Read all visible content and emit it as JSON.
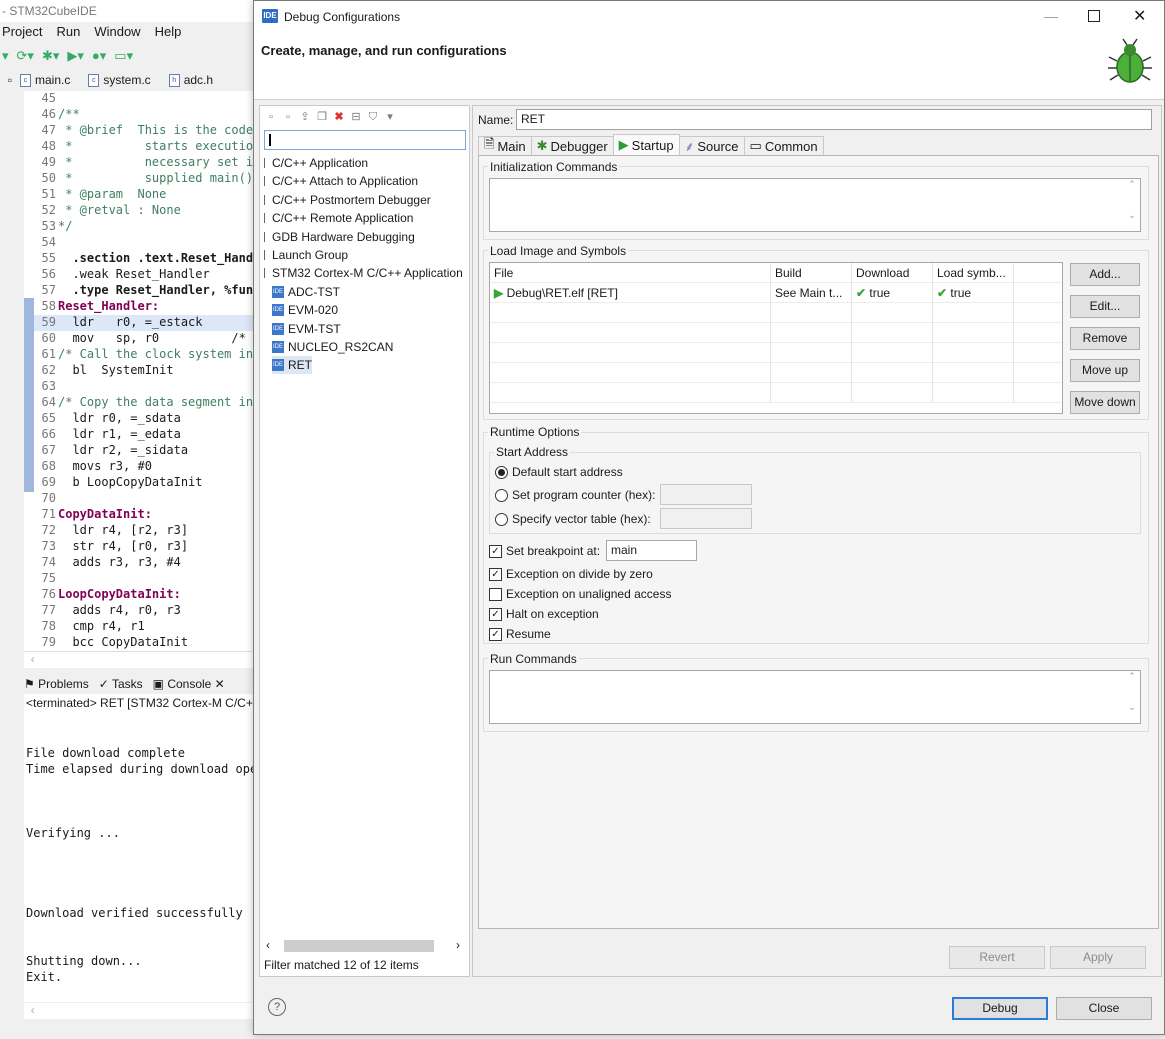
{
  "ide": {
    "title": "- STM32CubeIDE",
    "menu": [
      "Project",
      "Run",
      "Window",
      "Help"
    ],
    "editor_tabs": [
      "main.c",
      "system.c",
      "adc.h"
    ],
    "code": [
      {
        "n": "45",
        "t": ""
      },
      {
        "n": "46",
        "t": "/**"
      },
      {
        "n": "47",
        "t": " * @brief  This is the code"
      },
      {
        "n": "48",
        "t": " *          starts executio"
      },
      {
        "n": "49",
        "t": " *          necessary set i"
      },
      {
        "n": "50",
        "t": " *          supplied main()"
      },
      {
        "n": "51",
        "t": " * @param  None"
      },
      {
        "n": "52",
        "t": " * @retval : None"
      },
      {
        "n": "53",
        "t": "*/"
      },
      {
        "n": "54",
        "t": ""
      },
      {
        "n": "55",
        "t": "  .section .text.Reset_Hand"
      },
      {
        "n": "56",
        "t": "  .weak Reset_Handler"
      },
      {
        "n": "57",
        "t": "  .type Reset_Handler, %fun"
      },
      {
        "n": "58",
        "t": "Reset_Handler:"
      },
      {
        "n": "59",
        "t": "  ldr   r0, =_estack"
      },
      {
        "n": "60",
        "t": "  mov   sp, r0          /*"
      },
      {
        "n": "61",
        "t": "/* Call the clock system in"
      },
      {
        "n": "62",
        "t": "  bl  SystemInit"
      },
      {
        "n": "63",
        "t": ""
      },
      {
        "n": "64",
        "t": "/* Copy the data segment in"
      },
      {
        "n": "65",
        "t": "  ldr r0, =_sdata"
      },
      {
        "n": "66",
        "t": "  ldr r1, =_edata"
      },
      {
        "n": "67",
        "t": "  ldr r2, =_sidata"
      },
      {
        "n": "68",
        "t": "  movs r3, #0"
      },
      {
        "n": "69",
        "t": "  b LoopCopyDataInit"
      },
      {
        "n": "70",
        "t": ""
      },
      {
        "n": "71",
        "t": "CopyDataInit:"
      },
      {
        "n": "72",
        "t": "  ldr r4, [r2, r3]"
      },
      {
        "n": "73",
        "t": "  str r4, [r0, r3]"
      },
      {
        "n": "74",
        "t": "  adds r3, r3, #4"
      },
      {
        "n": "75",
        "t": ""
      },
      {
        "n": "76",
        "t": "LoopCopyDataInit:"
      },
      {
        "n": "77",
        "t": "  adds r4, r0, r3"
      },
      {
        "n": "78",
        "t": "  cmp r4, r1"
      },
      {
        "n": "79",
        "t": "  bcc CopyDataInit"
      }
    ],
    "console_tabs": [
      "Problems",
      "Tasks",
      "Console"
    ],
    "console_header": "<terminated> RET [STM32 Cortex-M C/C++",
    "console_lines": [
      "File download complete",
      "Time elapsed during download ope",
      "Verifying ...",
      "Download verified successfully",
      "Shutting down...",
      "Exit."
    ]
  },
  "dialog": {
    "title": "Debug Configurations",
    "header": "Create, manage, and run configurations",
    "tree": [
      "C/C++ Application",
      "C/C++ Attach to Application",
      "C/C++ Postmortem Debugger",
      "C/C++ Remote Application",
      "GDB Hardware Debugging",
      "Launch Group",
      "STM32 Cortex-M C/C++ Application"
    ],
    "tree_children": [
      "ADC-TST",
      "EVM-020",
      "EVM-TST",
      "NUCLEO_RS2CAN",
      "RET"
    ],
    "filter_status": "Filter matched 12 of 12 items",
    "name_label": "Name:",
    "name_value": "RET",
    "tabs": [
      "Main",
      "Debugger",
      "Startup",
      "Source",
      "Common"
    ],
    "active_tab": "Startup",
    "init_commands_label": "Initialization Commands",
    "load_image_label": "Load Image and Symbols",
    "table": {
      "columns": [
        "File",
        "Build",
        "Download",
        "Load symb..."
      ],
      "row": {
        "file": "Debug\\RET.elf [RET]",
        "build": "See Main t...",
        "download": "true",
        "load": "true"
      }
    },
    "side_buttons": [
      "Add...",
      "Edit...",
      "Remove",
      "Move up",
      "Move down"
    ],
    "runtime_label": "Runtime Options",
    "start_address_label": "Start Address",
    "radios": [
      "Default start address",
      "Set program counter (hex):",
      "Specify vector table (hex):"
    ],
    "breakpoint_label": "Set breakpoint at:",
    "breakpoint_value": "main",
    "checks": [
      {
        "label": "Exception on divide by zero",
        "checked": true
      },
      {
        "label": "Exception on unaligned access",
        "checked": false
      },
      {
        "label": "Halt on exception",
        "checked": true
      },
      {
        "label": "Resume",
        "checked": true
      }
    ],
    "run_commands_label": "Run Commands",
    "revert": "Revert",
    "apply": "Apply",
    "debug": "Debug",
    "close": "Close"
  }
}
